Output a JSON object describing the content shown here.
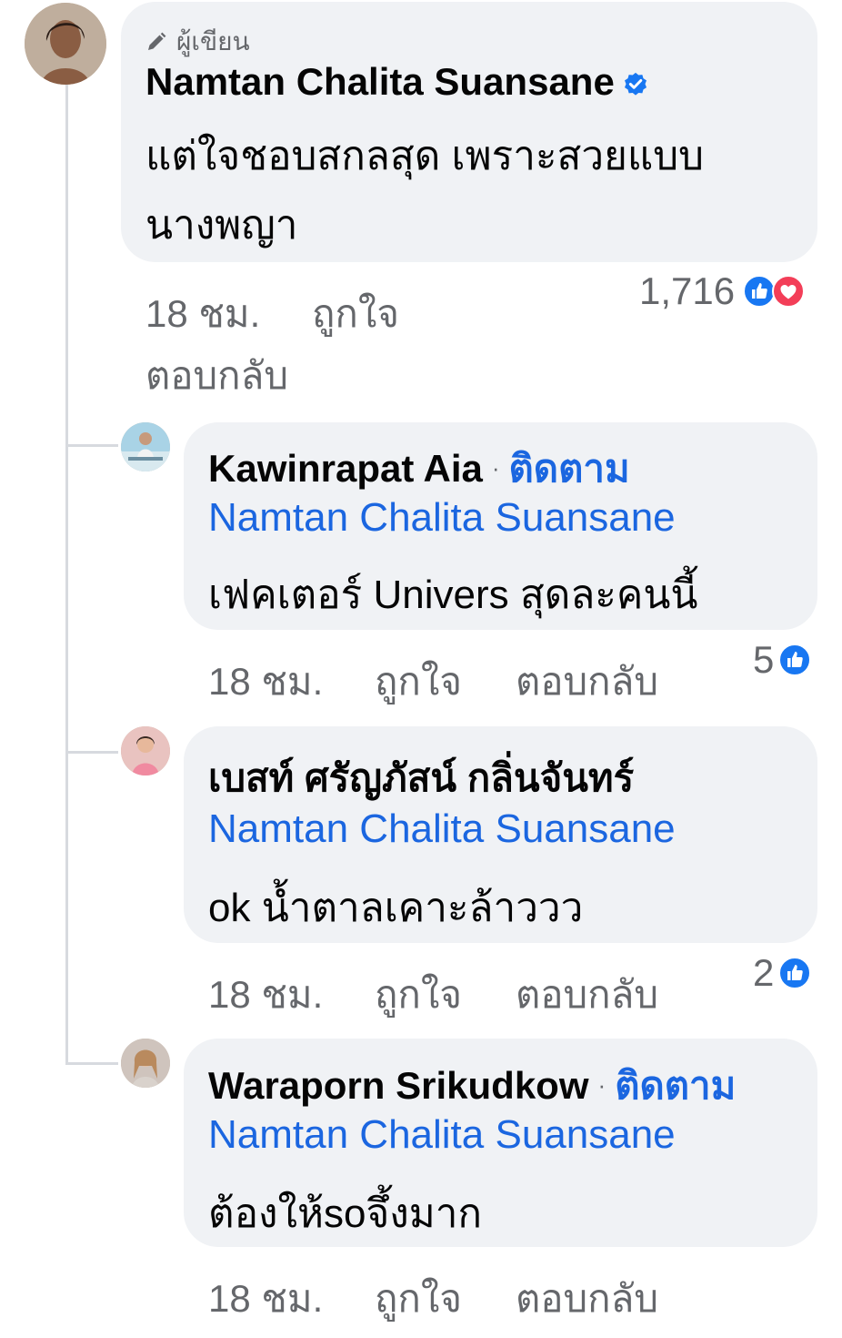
{
  "colors": {
    "link": "#1b66e0",
    "bubble": "#f0f2f5",
    "meta": "#65676b",
    "like": "#1877f2",
    "love": "#f33e58"
  },
  "main_comment": {
    "author_tag": "ผู้เขียน",
    "author_tag_icon": "pencil-icon",
    "name": "Namtan Chalita Suansane",
    "verified_icon": "verified-badge-icon",
    "text_line1": "แต่ใจชอบสกลสุด เพราะสวยแบบ",
    "text_line2": "นางพญา",
    "time": "18 ชม.",
    "like": "ถูกใจ",
    "reply": "ตอบกลับ",
    "reaction_count": "1,716",
    "reaction_icons": [
      "like-icon",
      "love-icon"
    ]
  },
  "replies": [
    {
      "name": "Kawinrapat Aia",
      "separator": "·",
      "follow": "ติดตาม",
      "mention": "Namtan Chalita Suansane",
      "text": "เฟคเตอร์ Univers สุดละคนนี้",
      "time": "18 ชม.",
      "like": "ถูกใจ",
      "reply": "ตอบกลับ",
      "reaction_count": "5",
      "reaction_icon": "like-icon"
    },
    {
      "name": "เบสท์ ศรัญภัสน์ กลิ่นจันทร์",
      "mention": "Namtan Chalita Suansane",
      "text": "ok น้ำตาลเคาะล้าววว",
      "time": "18 ชม.",
      "like": "ถูกใจ",
      "reply": "ตอบกลับ",
      "reaction_count": "2",
      "reaction_icon": "like-icon"
    },
    {
      "name": "Waraporn Srikudkow",
      "separator": "·",
      "follow": "ติดตาม",
      "mention": "Namtan Chalita Suansane",
      "text": "ต้องให้soจึ้งมาก",
      "time": "18 ชม.",
      "like": "ถูกใจ",
      "reply": "ตอบกลับ"
    }
  ]
}
